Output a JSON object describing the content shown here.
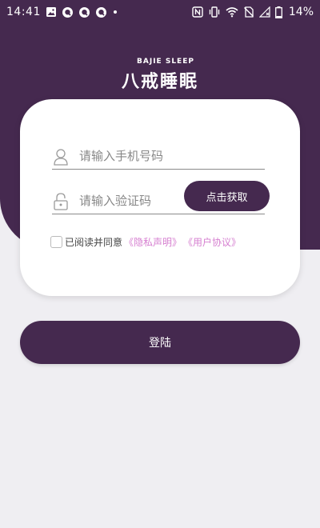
{
  "status_bar": {
    "time": "14:41",
    "battery": "14%",
    "left_icons": [
      "gallery-icon",
      "q-icon",
      "q-icon",
      "q-icon",
      "dot-icon"
    ],
    "right_icons": [
      "nfc-icon",
      "vibrate-icon",
      "wifi-icon",
      "no-sim-icon",
      "signal-icon",
      "battery-icon"
    ]
  },
  "logo": {
    "english": "BAJIE SLEEP",
    "chinese": "八戒睡眠"
  },
  "login_form": {
    "phone_placeholder": "请输入手机号码",
    "code_placeholder": "请输入验证码",
    "get_code_button": "点击获取",
    "agree_text": "已阅读并同意",
    "privacy_link": "《隐私声明》",
    "agreement_link": "《用户协议》"
  },
  "login_button": "登陆",
  "colors": {
    "primary": "#45294f",
    "background": "#efeef2",
    "card": "#ffffff",
    "link": "#d67fd0"
  }
}
